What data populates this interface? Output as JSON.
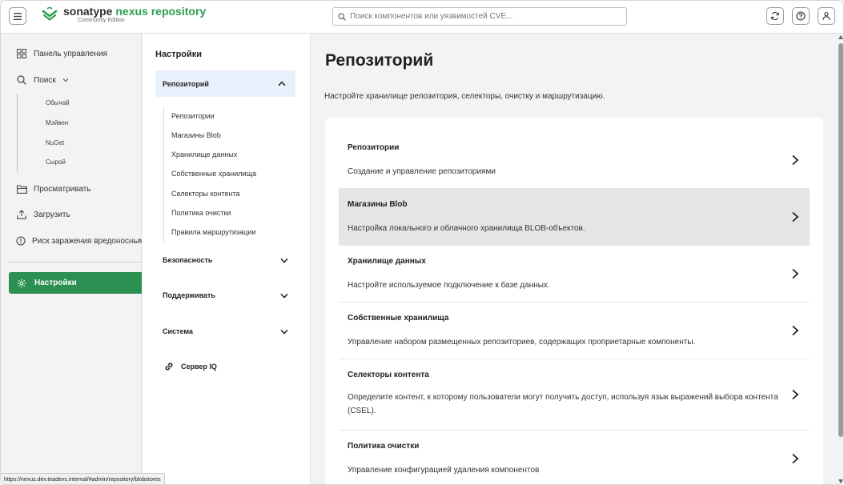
{
  "header": {
    "brand_prefix": "sonatype",
    "brand_name": "nexus repository",
    "edition": "Community Edition",
    "search_placeholder": "Поиск компонентов или уязвимостей CVE..."
  },
  "nav": {
    "items": [
      {
        "label": "Панель управления",
        "icon": "dashboard-icon"
      },
      {
        "label": "Поиск",
        "icon": "search-icon"
      },
      {
        "label": "Просматривать",
        "icon": "folder-icon"
      },
      {
        "label": "Загрузить",
        "icon": "upload-icon"
      },
      {
        "label": "Риск заражения вредоносным ПО",
        "icon": "alert-icon"
      }
    ],
    "search_sub": [
      "Обычай",
      "Мэйвен",
      "NuGet",
      "Сырой"
    ],
    "active": {
      "label": "Настройки",
      "icon": "gear-icon"
    }
  },
  "subnav": {
    "title": "Настройки",
    "selected": "Репозиторий",
    "links": [
      "Репозитории",
      "Магазины Blob",
      "Хранилище данных",
      "Собственные хранилища",
      "Селекторы контента",
      "Политика очистки",
      "Правила маршрутизации"
    ],
    "groups": [
      "Безопасность",
      "Поддерживать",
      "Система"
    ],
    "iq": "Сервер IQ"
  },
  "main": {
    "title": "Репозиторий",
    "description": "Настройте хранилище репозитория, селекторы, очистку и маршрутизацию.",
    "rows": [
      {
        "title": "Репозитории",
        "desc": "Создание и управление репозиториями"
      },
      {
        "title": "Магазины Blob",
        "desc": "Настройка локального и облачного хранилища BLOB-объектов."
      },
      {
        "title": "Хранилище данных",
        "desc": "Настройте используемое подключение к базе данных."
      },
      {
        "title": "Собственные хранилища",
        "desc": "Управление набором размещенных репозиториев, содержащих проприетарные компоненты."
      },
      {
        "title": "Селекторы контента",
        "desc": "Определите контент, к которому пользователи могут получить доступ, используя язык выражений выбора контента (CSEL)."
      },
      {
        "title": "Политика очистки",
        "desc": "Управление конфигурацией удаления компонентов"
      }
    ]
  },
  "status_url": "https://nexus.dev.teadevs.internal/#admin/repository/blobstores",
  "colors": {
    "accent": "#2a8f51",
    "selected_bg": "#e8f0fb",
    "hover_row": "#e5e5e5"
  }
}
